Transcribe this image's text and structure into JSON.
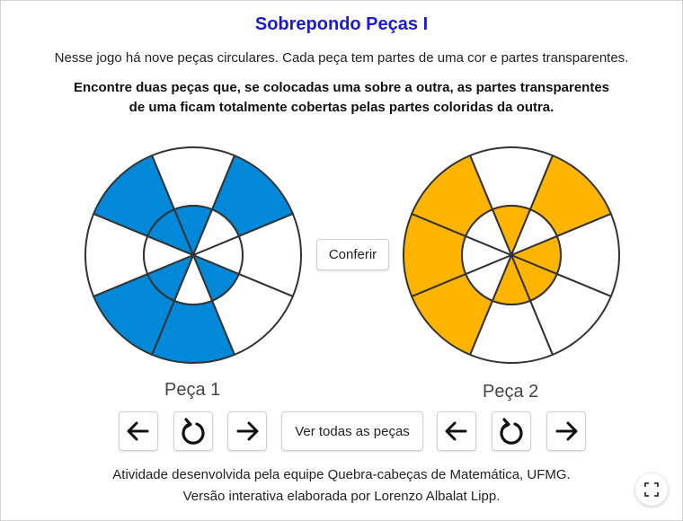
{
  "title": "Sobrepondo Peças I",
  "intro": "Nesse jogo há nove peças circulares. Cada peça tem partes de uma cor e partes transparentes.",
  "task_line1": "Encontre duas peças que, se colocadas uma sobre a outra, as partes transparentes",
  "task_line2": "de uma ficam totalmente cobertas pelas partes coloridas da outra.",
  "check_button": "Conferir",
  "view_all_button": "Ver todas as peças",
  "piece1": {
    "label": "Peça 1",
    "color": "#0288d8",
    "outer_filled": [
      7,
      1,
      4,
      5
    ],
    "inner_filled": [
      0,
      7,
      3,
      5
    ]
  },
  "piece2": {
    "label": "Peça 2",
    "color": "#ffb400",
    "outer_filled": [
      6,
      7,
      1,
      5
    ],
    "inner_filled": [
      0,
      2,
      3,
      4
    ]
  },
  "controls": {
    "piece1_prev_icon": "arrow-left-icon",
    "piece1_rotate_icon": "rotate-icon",
    "piece1_next_icon": "arrow-right-icon",
    "piece2_prev_icon": "arrow-left-icon",
    "piece2_rotate_icon": "rotate-icon",
    "piece2_next_icon": "arrow-right-icon",
    "fullscreen_icon": "fullscreen-icon"
  },
  "footer_line1": "Atividade desenvolvida pela equipe Quebra-cabeças de Matemática, UFMG.",
  "footer_line2": "Versão interativa elaborada por Lorenzo Albalat Lipp."
}
